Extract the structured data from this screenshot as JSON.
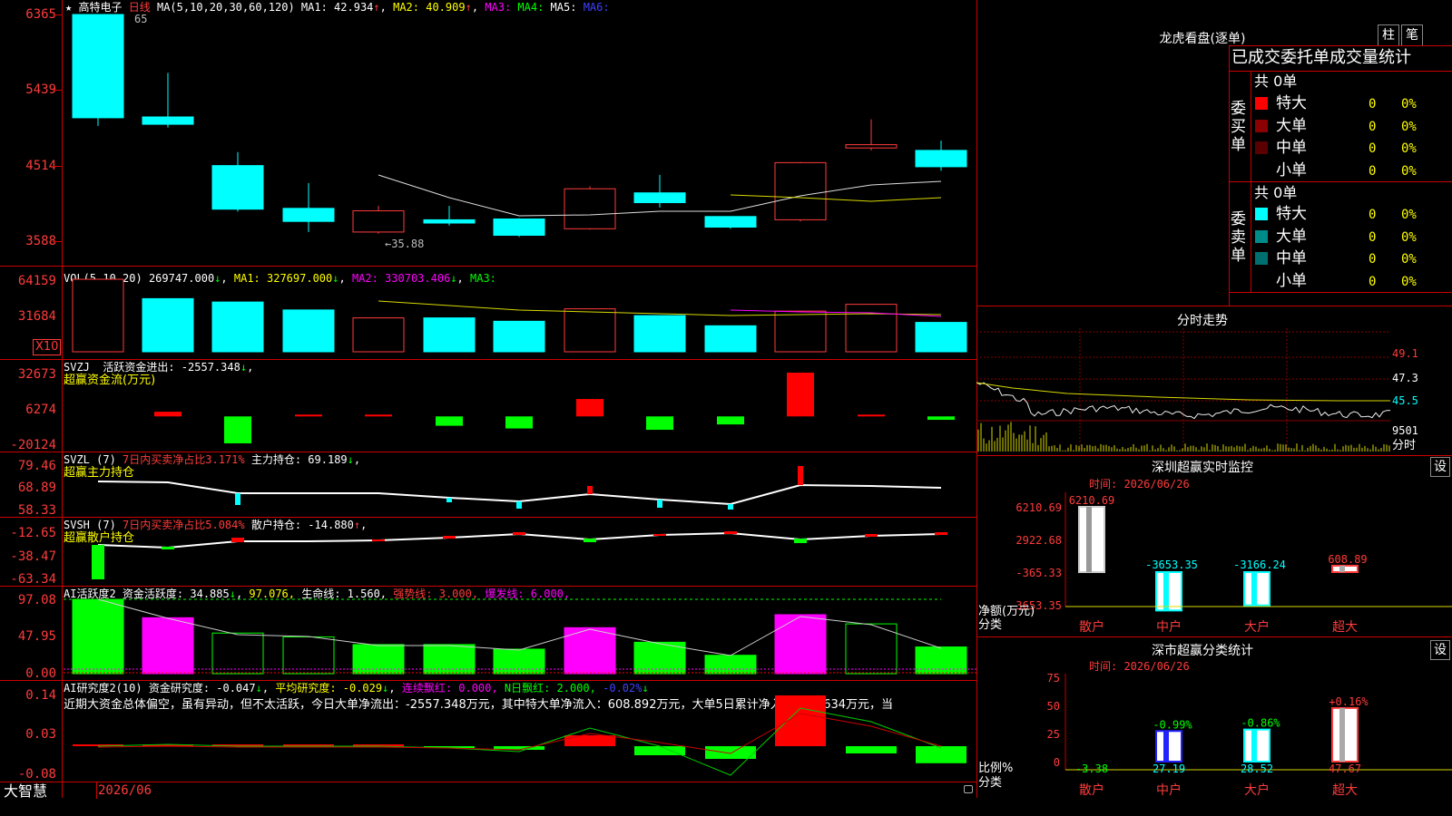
{
  "kline": {
    "star": "★",
    "stock_name": "高特电子",
    "period": "日线",
    "ma_params": "MA(5,10,20,30,60,120)",
    "ma1": "MA1: 42.934",
    "ma2": "MA2: 40.909",
    "ma3": "MA3:",
    "ma4": "MA4:",
    "ma5": "MA5:",
    "ma6": "MA6:",
    "hi_mark": "65",
    "lo_mark": "←35.88",
    "y_labels": [
      "6365",
      "5439",
      "4514",
      "3588"
    ]
  },
  "vol": {
    "title": "VOL(5,10,20)",
    "v": "269747.000",
    "ma1": "MA1: 327697.000",
    "ma2": "MA2: 330703.406",
    "ma3": "MA3:",
    "y_labels": [
      "64159",
      "31684"
    ],
    "unit": "X10"
  },
  "svzj": {
    "title": "SVZJ",
    "line1": "活跃资金进出: -2557.348",
    "line2": "超赢资金流(万元)",
    "y_labels": [
      "32673",
      "6274",
      "-20124"
    ]
  },
  "svzl": {
    "title": "SVZL (7)",
    "red_text": "7日内买卖净占比3.171%",
    "white_text": "主力持仓: 69.189",
    "line2": "超赢主力持仓",
    "y_labels": [
      "79.46",
      "68.89",
      "58.33"
    ]
  },
  "svsh": {
    "title": "SVSH (7)",
    "red_text": "7日内买卖净占比5.084%",
    "white_text": "散户持仓: -14.880",
    "line2": "超赢散户持仓",
    "y_labels": [
      "-12.65",
      "-38.47",
      "-63.34"
    ]
  },
  "ai1": {
    "title": "AI活跃度2",
    "t1": "资金活跃度: 34.885",
    "t2": "97.076,",
    "t3": "生命线: 1.560,",
    "t4": "强势线: 3.000,",
    "t5": "爆发线: 6.000,",
    "y_labels": [
      "97.08",
      "47.95",
      "0.00"
    ]
  },
  "ai2": {
    "title": "AI研究度2(10)",
    "t1": "资金研究度: -0.047",
    "t2": "平均研究度: -0.029",
    "t3": "连续飘红: 0.000,",
    "t4": "N日飘红: 2.000,",
    "t5": "-0.02%",
    "comment": "近期大资金总体偏空，虽有异动，但不太活跃，今日大单净流出：-2557.348万元，其中特大单净流入：608.892万元，大单5日累计净入12414.634万元，当",
    "y_labels": [
      "0.14",
      "0.03",
      "-0.08"
    ]
  },
  "footer": {
    "brand": "大智慧",
    "date": "2026/06"
  },
  "dragon": {
    "title": "龙虎看盘(逐单)",
    "btn1": "柱",
    "btn2": "笔",
    "header": "已成交委托单成交量统计",
    "buy_label": "委买单",
    "sell_label": "委卖单",
    "buy_total": "共 0单",
    "sell_total": "共 0单",
    "buy_rows": [
      {
        "name": "特大",
        "count": "0",
        "pct": "0%",
        "color": "#ff0000"
      },
      {
        "name": "大单",
        "count": "0",
        "pct": "0%",
        "color": "#8b0000"
      },
      {
        "name": "中单",
        "count": "0",
        "pct": "0%",
        "color": "#5a0000"
      },
      {
        "name": "小单",
        "count": "0",
        "pct": "0%",
        "color": "#000000"
      }
    ],
    "sell_rows": [
      {
        "name": "特大",
        "count": "0",
        "pct": "0%",
        "color": "#00ffff"
      },
      {
        "name": "大单",
        "count": "0",
        "pct": "0%",
        "color": "#008b8b"
      },
      {
        "name": "中单",
        "count": "0",
        "pct": "0%",
        "color": "#006f6f"
      },
      {
        "name": "小单",
        "count": "0",
        "pct": "0%",
        "color": "#000000"
      }
    ]
  },
  "intraday": {
    "title": "分时走势",
    "y_labels": [
      "49.1",
      "47.3",
      "45.5"
    ],
    "vol_labels": [
      "9501",
      "分时"
    ]
  },
  "monitor": {
    "title": "深圳超赢实时监控",
    "btn": "设",
    "time": "时间: 2026/06/26",
    "y_labels": [
      "6210.69",
      "2922.68",
      "-365.33",
      "-3653.35"
    ],
    "ylabel1": "净额(万元)",
    "ylabel2": "分类",
    "categories": [
      "散户",
      "中户",
      "大户",
      "超大"
    ],
    "values": [
      6210.69,
      -3653.35,
      -3166.24,
      608.89
    ],
    "value_labels": [
      "6210.69",
      "-3653.35",
      "-3166.24",
      "608.89"
    ]
  },
  "stat": {
    "title": "深市超赢分类统计",
    "btn": "设",
    "time": "时间: 2026/06/26",
    "y_labels": [
      "75",
      "50",
      "25",
      "0"
    ],
    "ylabel1": "比例%",
    "ylabel2": "分类",
    "categories": [
      "散户",
      "中户",
      "大户",
      "超大"
    ],
    "values": [
      -3.38,
      27.19,
      28.52,
      47.67
    ],
    "changes": [
      "",
      "-0.99%",
      "-0.86%",
      "+0.16%"
    ]
  },
  "chart_data": [
    {
      "type": "candlestick",
      "ylim": [
        3588,
        6365
      ],
      "candles": [
        {
          "open": 6365,
          "close": 5100,
          "high": 6365,
          "low": 5000,
          "up": false
        },
        {
          "open": 5110,
          "close": 5020,
          "high": 5650,
          "low": 4980,
          "up": false
        },
        {
          "open": 4514,
          "close": 3980,
          "high": 4680,
          "low": 3950,
          "up": false
        },
        {
          "open": 3990,
          "close": 3830,
          "high": 4300,
          "low": 3700,
          "up": false
        },
        {
          "open": 3960,
          "close": 3700,
          "high": 4020,
          "low": 3680,
          "up": true
        },
        {
          "open": 3850,
          "close": 3810,
          "high": 4020,
          "low": 3780,
          "up": false
        },
        {
          "open": 3860,
          "close": 3660,
          "high": 3870,
          "low": 3640,
          "up": false
        },
        {
          "open": 3740,
          "close": 4230,
          "high": 4260,
          "low": 3730,
          "up": true
        },
        {
          "open": 4180,
          "close": 4060,
          "high": 4400,
          "low": 4000,
          "up": false
        },
        {
          "open": 3890,
          "close": 3760,
          "high": 3890,
          "low": 3740,
          "up": false
        },
        {
          "open": 3850,
          "close": 4550,
          "high": 4560,
          "low": 3830,
          "up": true
        },
        {
          "open": 4730,
          "close": 4770,
          "high": 5080,
          "low": 4700,
          "up": true
        },
        {
          "open": 4700,
          "close": 4500,
          "high": 4820,
          "low": 4450,
          "up": false
        }
      ]
    },
    {
      "type": "bar",
      "name": "VOL",
      "values": [
        64159,
        47000,
        44000,
        37000,
        30000,
        30000,
        27000,
        38000,
        32000,
        23000,
        36000,
        42000,
        26000
      ],
      "up": [
        true,
        false,
        false,
        false,
        true,
        false,
        false,
        true,
        false,
        false,
        true,
        true,
        false
      ]
    },
    {
      "type": "bar",
      "name": "SVZJ",
      "values": [
        0,
        3500,
        -20124,
        300,
        300,
        -7000,
        -9000,
        13000,
        -10000,
        -6000,
        32673,
        400,
        -2557
      ]
    },
    {
      "type": "bar",
      "name": "AI活跃度2",
      "values": [
        97.08,
        73,
        53,
        48,
        38,
        38,
        32,
        60,
        41,
        24,
        77,
        65,
        34.885
      ],
      "colors": [
        "#00ff00",
        "#ff00ff",
        "hollow",
        "hollow",
        "#00ff00",
        "#00ff00",
        "#00ff00",
        "#ff00ff",
        "#00ff00",
        "#00ff00",
        "#ff00ff",
        "hollow",
        "#00ff00"
      ]
    },
    {
      "type": "bar",
      "name": "AI研究度2",
      "values": [
        0,
        0.005,
        0.0,
        0.0,
        0.0,
        -0.005,
        -0.01,
        0.03,
        -0.025,
        -0.035,
        0.14,
        -0.02,
        -0.047
      ]
    }
  ]
}
